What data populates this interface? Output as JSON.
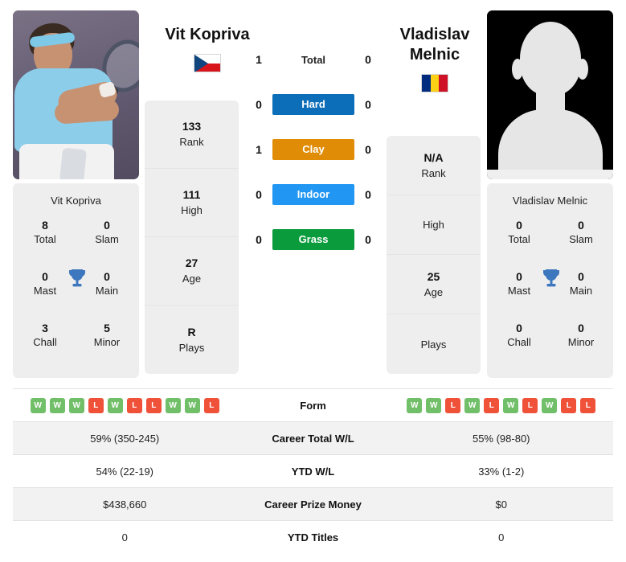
{
  "players": {
    "left": {
      "name": "Vit Kopriva",
      "flag": "czech-flag",
      "photo": "player-photo",
      "rank": "133",
      "rank_label": "Rank",
      "high": "111",
      "high_label": "High",
      "age": "27",
      "age_label": "Age",
      "plays": "R",
      "plays_label": "Plays",
      "titles": {
        "total": "8",
        "total_label": "Total",
        "slam": "0",
        "slam_label": "Slam",
        "mast": "0",
        "mast_label": "Mast",
        "main": "0",
        "main_label": "Main",
        "chall": "3",
        "chall_label": "Chall",
        "minor": "5",
        "minor_label": "Minor"
      },
      "form": [
        "W",
        "W",
        "W",
        "L",
        "W",
        "L",
        "L",
        "W",
        "W",
        "L"
      ],
      "career_wl": "59% (350-245)",
      "ytd_wl": "54% (22-19)",
      "career_prize": "$438,660",
      "ytd_titles": "0"
    },
    "right": {
      "name": "Vladislav Melnic",
      "name_line1": "Vladislav",
      "name_line2": "Melnic",
      "flag": "romania-flag",
      "photo": "player-avatar-placeholder",
      "rank": "N/A",
      "rank_label": "Rank",
      "high": "",
      "high_label": "High",
      "age": "25",
      "age_label": "Age",
      "plays": "",
      "plays_label": "Plays",
      "titles": {
        "total": "0",
        "total_label": "Total",
        "slam": "0",
        "slam_label": "Slam",
        "mast": "0",
        "mast_label": "Mast",
        "main": "0",
        "main_label": "Main",
        "chall": "0",
        "chall_label": "Chall",
        "minor": "0",
        "minor_label": "Minor"
      },
      "form": [
        "W",
        "W",
        "L",
        "W",
        "L",
        "W",
        "L",
        "W",
        "L",
        "L"
      ],
      "career_wl": "55% (98-80)",
      "ytd_wl": "33% (1-2)",
      "career_prize": "$0",
      "ytd_titles": "0"
    }
  },
  "head_to_head": {
    "rows": [
      {
        "label": "Total",
        "left": "1",
        "right": "0",
        "style": "plain",
        "color": ""
      },
      {
        "label": "Hard",
        "left": "0",
        "right": "0",
        "style": "badge",
        "color": "#0c6eb9"
      },
      {
        "label": "Clay",
        "left": "1",
        "right": "0",
        "style": "badge",
        "color": "#e08c06"
      },
      {
        "label": "Indoor",
        "left": "0",
        "right": "0",
        "style": "badge",
        "color": "#2197f3"
      },
      {
        "label": "Grass",
        "left": "0",
        "right": "0",
        "style": "badge",
        "color": "#0a9b3d"
      }
    ]
  },
  "stats_table": {
    "rows": [
      {
        "label": "Form",
        "type": "form"
      },
      {
        "label": "Career Total W/L",
        "type": "text",
        "key": "career_wl"
      },
      {
        "label": "YTD W/L",
        "type": "text",
        "key": "ytd_wl"
      },
      {
        "label": "Career Prize Money",
        "type": "text",
        "key": "career_prize"
      },
      {
        "label": "YTD Titles",
        "type": "text",
        "key": "ytd_titles"
      }
    ]
  },
  "colors": {
    "hard": "#0c6eb9",
    "clay": "#e08c06",
    "indoor": "#2197f3",
    "grass": "#0a9b3d",
    "win": "#72bf6a",
    "loss": "#ef5139",
    "card_bg": "#eeeeee",
    "row_alt_bg": "#f2f2f2",
    "trophy": "#3d77bd"
  }
}
